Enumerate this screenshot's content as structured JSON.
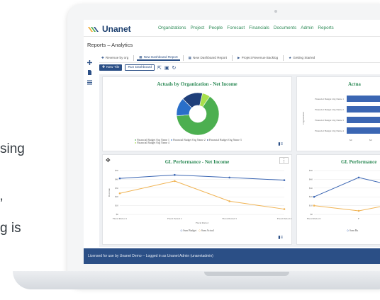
{
  "bg_text": [
    "sing",
    "’",
    "g is"
  ],
  "app": {
    "brand": "Unanet"
  },
  "nav": {
    "items": [
      "Organizations",
      "Project",
      "People",
      "Forecast",
      "Financials",
      "Documents",
      "Admin",
      "Reports"
    ]
  },
  "breadcrumb": "Reports – Analytics",
  "tabs": [
    {
      "label": "Revenue by org",
      "icon": "plus-icon"
    },
    {
      "label": "New Dashboard Report",
      "icon": "grid-icon",
      "active": true
    },
    {
      "label": "New Dashboard Report",
      "icon": "grid-icon"
    },
    {
      "label": "Project Revenue Backlog",
      "icon": "play-icon"
    },
    {
      "label": "Getting Started",
      "icon": "star-icon"
    }
  ],
  "toolbar": {
    "new_tile": "New Tile",
    "run_dashboard": "Run Dashboard"
  },
  "footer": {
    "text": "Licensed for use by Unanet Demo -- Logged in as Unanet Admin (unanetadmin)"
  },
  "cards": {
    "pie": {
      "title": "Actuals by Organization - Net Income",
      "legend": [
        "Financial Budget Org Name 1",
        "Financial Budget Org Name 2",
        "Financial Budget Org Name 3",
        "Financial Budget Org Name 4"
      ]
    },
    "hbar": {
      "title": "Actua",
      "ylabel": "Organization",
      "categories": [
        "Financial Budget Org Name 1",
        "Financial Budget Org Name 2",
        "Financial Budget Org Name 3",
        "Financial Budget Org Name 4"
      ],
      "ticks": [
        "$0",
        "$0"
      ]
    },
    "line1": {
      "title": "GL Performance - Net Income",
      "ylabel": "Revenue",
      "xlabel": "Fiscal Period",
      "yticks": [
        "$50",
        "$40",
        "$30",
        "$20",
        "$10",
        "$0"
      ],
      "xticks": [
        "Fiscal Period 1",
        "Fiscal Period 2",
        "Fiscal Period 3",
        "Fiscal Period 4"
      ],
      "legend": [
        "Sum Budget",
        "Sum Actual"
      ]
    },
    "line2": {
      "title": "GL Performance",
      "yticks": [
        "$50",
        "$40",
        "$30",
        "$20",
        "$10",
        "$0"
      ],
      "xticks": [
        "Fiscal Period 1",
        "F"
      ],
      "legend": [
        "Sum Bu"
      ]
    }
  },
  "chart_data": [
    {
      "type": "pie",
      "title": "Actuals by Organization - Net Income",
      "categories": [
        "Financial Budget Org Name 1",
        "Financial Budget Org Name 2",
        "Financial Budget Org Name 3",
        "Financial Budget Org Name 4"
      ],
      "values": [
        64,
        14,
        16,
        6
      ],
      "colors": [
        "#4caf50",
        "#2a6fc9",
        "#1f3f7a",
        "#a8e04c"
      ]
    },
    {
      "type": "line",
      "title": "GL Performance - Net Income",
      "categories": [
        "Fiscal Period 1",
        "Fiscal Period 2",
        "Fiscal Period 3",
        "Fiscal Period 4"
      ],
      "ylabel": "Revenue",
      "xlabel": "Fiscal Period",
      "ylim": [
        0,
        50
      ],
      "series": [
        {
          "name": "Sum Budget",
          "values": [
            41,
            45,
            42,
            39
          ],
          "color": "#3b66b3"
        },
        {
          "name": "Sum Actual",
          "values": [
            24,
            38,
            15,
            6
          ],
          "color": "#f0b455"
        }
      ]
    },
    {
      "type": "line",
      "title": "GL Performance",
      "categories": [
        "Fiscal Period 1",
        "Fiscal Period 2",
        "Fiscal Period 3"
      ],
      "ylim": [
        0,
        50
      ],
      "series": [
        {
          "name": "Sum Bu",
          "values": [
            20,
            42,
            30
          ],
          "color": "#3b66b3"
        },
        {
          "name": "",
          "values": [
            10,
            4,
            14
          ],
          "color": "#f0b455"
        }
      ]
    }
  ]
}
